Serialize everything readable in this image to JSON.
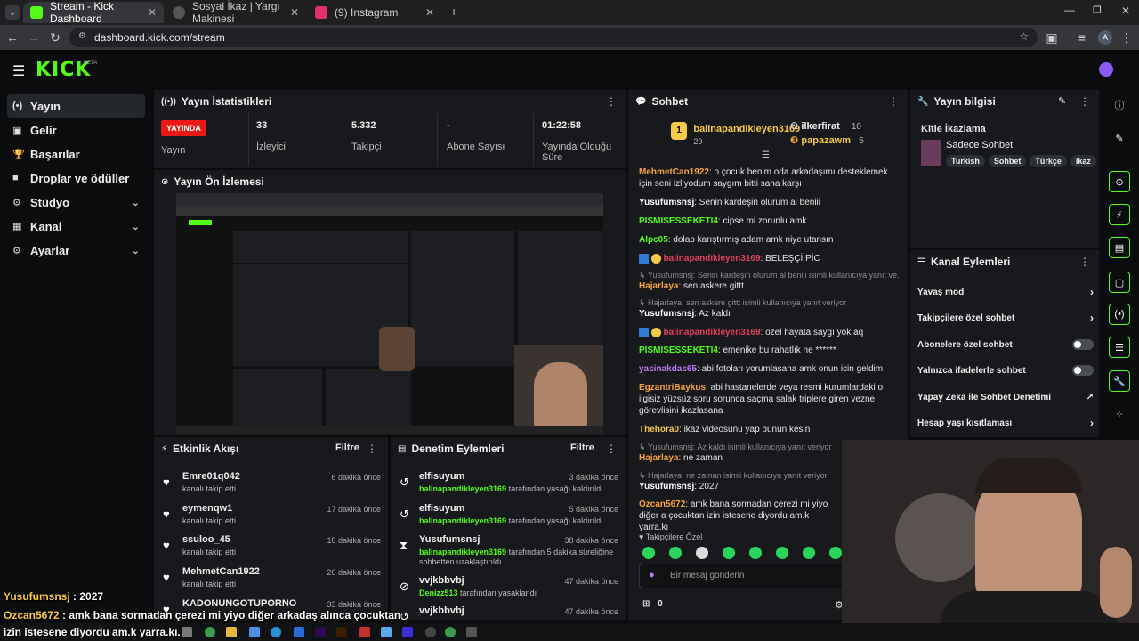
{
  "browser": {
    "tabs": [
      {
        "label": "Stream - Kick Dashboard",
        "active": true
      },
      {
        "label": "Sosyal İkaz | Yargı Makinesi",
        "active": false
      },
      {
        "label": "(9) Instagram",
        "active": false
      }
    ],
    "url": "dashboard.kick.com/stream",
    "profile_initial": "A"
  },
  "kick": {
    "logo": "KICK",
    "beta": "BETA"
  },
  "sidebar": {
    "items": [
      {
        "label": "Yayın",
        "icon": "broadcast-icon"
      },
      {
        "label": "Gelir",
        "icon": "wallet-icon"
      },
      {
        "label": "Başarılar",
        "icon": "trophy-icon"
      },
      {
        "label": "Droplar ve ödüller",
        "icon": "gift-icon"
      },
      {
        "label": "Stüdyo",
        "icon": "studio-icon"
      },
      {
        "label": "Kanal",
        "icon": "channel-icon"
      },
      {
        "label": "Ayarlar",
        "icon": "gear-icon"
      }
    ]
  },
  "stats": {
    "title": "Yayın İstatistikleri",
    "live_badge": "YAYINDA",
    "live_label": "Yayın",
    "viewers": "33",
    "viewers_label": "İzleyici",
    "followers": "5.332",
    "followers_label": "Takipçi",
    "subs": "-",
    "subs_label": "Abone Sayısı",
    "uptime": "01:22:58",
    "uptime_label": "Yayında Olduğu Süre"
  },
  "preview": {
    "title": "Yayın Ön İzlemesi"
  },
  "activity": {
    "title": "Etkinlik Akışı",
    "filter": "Filtre",
    "items": [
      {
        "name": "Emre01q042",
        "sub": "kanalı takip etti",
        "time": "6 dakika önce"
      },
      {
        "name": "eymenqw1",
        "sub": "kanalı takip etti",
        "time": "17 dakika önce"
      },
      {
        "name": "ssuloo_45",
        "sub": "kanalı takip etti",
        "time": "18 dakika önce"
      },
      {
        "name": "MehmetCan1922",
        "sub": "kanalı takip etti",
        "time": "26 dakika önce"
      },
      {
        "name": "KADONUNGOTUPORNO",
        "sub": "",
        "time": "33 dakika önce"
      }
    ]
  },
  "moderation": {
    "title": "Denetim Eylemleri",
    "filter": "Filtre",
    "items": [
      {
        "name": "elfisuyum",
        "mod": "balinapandikleyen3169",
        "sub": "tarafından yasağı kaldırıldı",
        "time": "3 dakika önce"
      },
      {
        "name": "elfisuyum",
        "mod": "balinapandikleyen3169",
        "sub": "tarafından yasağı kaldırıldı",
        "time": "5 dakika önce"
      },
      {
        "name": "Yusufumsnsj",
        "mod": "balinapandikleyen3169",
        "sub": "tarafından 5 dakika süreliğine sohbetten uzaklaştırıldı",
        "time": "38 dakika önce"
      },
      {
        "name": "vvjkbbvbj",
        "mod": "Denizz513",
        "sub": "tarafından yasaklandı",
        "time": "47 dakika önce"
      },
      {
        "name": "vvjkbbvbj",
        "mod": "",
        "sub": "",
        "time": "47 dakika önce"
      }
    ]
  },
  "chat": {
    "title": "Sohbet",
    "top_gifter": "balinapandikleyen3169",
    "top_gifter_count": "29",
    "gifter2": "ilkerfirat",
    "gifter2_count": "10",
    "gifter3": "papazawm",
    "gifter3_count": "5",
    "messages": [
      {
        "user": "MehmetCan1922",
        "color": "#f7a23b",
        "text": ": o çocuk benim oda arkadaşımı desteklemek için seni izliyodum saygım bitti sana karşı"
      },
      {
        "user": "Yusufumsnsj",
        "color": "#ffffff",
        "text": ": Senin kardeşin olurum al beniii"
      },
      {
        "user": "PISMISESSEKETI4",
        "color": "#53fc18",
        "text": ": cipse mi zorunlu amk"
      },
      {
        "user": "Alpc05",
        "color": "#53fc18",
        "text": ": dolap karıştırmış adam amk niye utansın"
      },
      {
        "user": "balinapandikleyen3169",
        "color": "#e0415b",
        "text": ": BELEŞÇİ PİC"
      },
      {
        "reply": "Yusufumsnsj: Senin kardeşin olurum al beniii isimli kullanıcıya yanıt ve..."
      },
      {
        "user": "Hajarlaya",
        "color": "#f7a23b",
        "text": ": sen askere gittt"
      },
      {
        "reply": "Hajarlaya: sen askere gittt isimli kullanıcıya yanıt veriyor"
      },
      {
        "user": "Yusufumsnsj",
        "color": "#ffffff",
        "text": ": Az kaldı"
      },
      {
        "user": "balinapandikleyen3169",
        "color": "#e0415b",
        "text": ": özel hayata saygı yok aq"
      },
      {
        "user": "PISMISESSEKETI4",
        "color": "#53fc18",
        "text": ": emenike bu rahatlık ne ******"
      },
      {
        "user": "yasinakdas65",
        "color": "#c07af7",
        "text": ": abi fotoları yorumlasana amk onun icin geldim"
      },
      {
        "user": "EgzantriBaykus",
        "color": "#f7a23b",
        "text": ": abi hastanelerde veya resmi kurumlardaki o ilgisiz yüzsüz soru sorunca saçma salak triplere giren vezne görevlisini ikazlasana"
      },
      {
        "user": "Thehora0",
        "color": "#f7c948",
        "text": ": ikaz videosunu yap bunun kesin"
      },
      {
        "reply": "Yusufumsnsj: Az kaldı isimli kullanıcıya yanıt veriyor"
      },
      {
        "user": "Hajarlaya",
        "color": "#f7a23b",
        "text": ": ne zaman"
      },
      {
        "reply": "Hajarlaya: ne zaman isimli kullanıcıya yanıt veriyor"
      },
      {
        "user": "Yusufumsnsj",
        "color": "#ffffff",
        "text": ": 2027"
      },
      {
        "user": "Ozcan5672",
        "color": "#f7a23b",
        "text": ": amk bana sormadan çerezi mi yiyo diğer a çocuktan izin istesene diyordu am.k yarra.kı"
      }
    ],
    "followers_only": "Takipçilere Özel",
    "input_placeholder": "Bir mesaj gönderin",
    "points": "0"
  },
  "stream_info": {
    "title": "Yayın bilgisi",
    "stream_title": "Kitle İkazlama",
    "category": "Sadece Sohbet",
    "tags": [
      "Turkish",
      "Sohbet",
      "Türkçe",
      "ikaz"
    ]
  },
  "channel_actions": {
    "title": "Kanal Eylemleri",
    "items": [
      {
        "label": "Yavaş mod",
        "kind": "chevron"
      },
      {
        "label": "Takipçilere özel sohbet",
        "kind": "chevron"
      },
      {
        "label": "Abonelere özel sohbet",
        "kind": "toggle"
      },
      {
        "label": "Yalnızca ifadelerle sohbet",
        "kind": "toggle"
      },
      {
        "label": "Yapay Zeka ile Sohbet Denetimi",
        "kind": "external"
      },
      {
        "label": "Hesap yaşı kısıtlaması",
        "kind": "chevron"
      }
    ]
  },
  "overlay": {
    "line1_user": "Yusufumsnsj",
    "line1_text": " : 2027",
    "line2_user": "Ozcan5672",
    "line2_text": " : amk bana sormadan çerezi mi yiyo diğer arkadaş alınca çocuktan",
    "line3_text": "izin istesene diyordu am.k yarra.kı."
  },
  "colors": {
    "accent": "#53fc18",
    "live": "#e91916",
    "panel": "#17191c"
  }
}
